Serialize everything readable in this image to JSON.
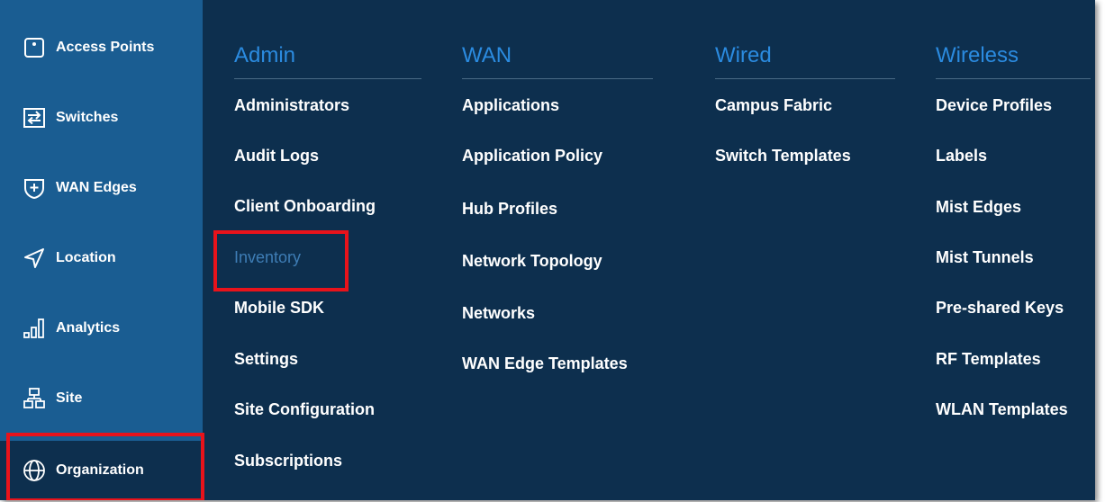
{
  "sidebar": {
    "items": [
      {
        "label": "Access Points",
        "icon": "access-point-icon"
      },
      {
        "label": "Switches",
        "icon": "switch-icon"
      },
      {
        "label": "WAN Edges",
        "icon": "wan-edge-icon"
      },
      {
        "label": "Location",
        "icon": "location-icon"
      },
      {
        "label": "Analytics",
        "icon": "analytics-icon"
      },
      {
        "label": "Site",
        "icon": "site-icon"
      },
      {
        "label": "Organization",
        "icon": "globe-icon"
      }
    ],
    "active": "Organization"
  },
  "menu": {
    "admin": {
      "title": "Admin",
      "items": [
        "Administrators",
        "Audit Logs",
        "Client Onboarding",
        "Inventory",
        "Mobile SDK",
        "Settings",
        "Site Configuration",
        "Subscriptions"
      ],
      "selected": "Inventory"
    },
    "wan": {
      "title": "WAN",
      "items": [
        "Applications",
        "Application Policy",
        "Hub Profiles",
        "Network Topology",
        "Networks",
        "WAN Edge Templates"
      ]
    },
    "wired": {
      "title": "Wired",
      "items": [
        "Campus Fabric",
        "Switch Templates"
      ]
    },
    "wireless": {
      "title": "Wireless",
      "items": [
        "Device Profiles",
        "Labels",
        "Mist Edges",
        "Mist Tunnels",
        "Pre-shared Keys",
        "RF Templates",
        "WLAN Templates"
      ]
    }
  },
  "colors": {
    "sidebar_bg": "#1a5d92",
    "panel_bg": "#0d2f4e",
    "header_blue": "#2b8be0",
    "highlight_red": "#e8131b"
  }
}
